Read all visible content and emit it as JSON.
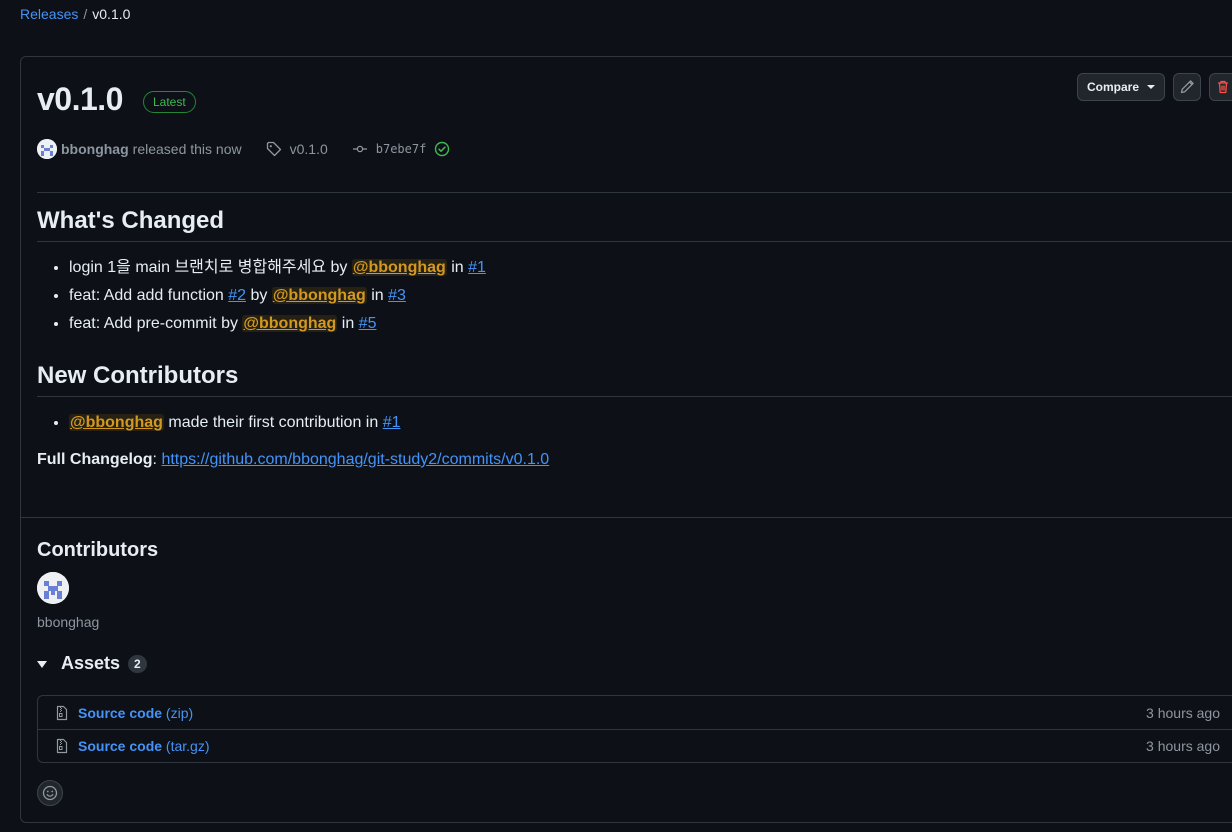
{
  "breadcrumb": {
    "releases_label": "Releases",
    "separator": "/",
    "current": "v0.1.0"
  },
  "release": {
    "title": "v0.1.0",
    "badge": "Latest",
    "author": "bbonghag",
    "released_text": "released this now",
    "tag": "v0.1.0",
    "commit": "b7ebe7f",
    "commit_status": "verified-check"
  },
  "actions": {
    "compare_label": "Compare",
    "edit_icon": "pencil-icon",
    "delete_icon": "trash-icon"
  },
  "whats_changed": {
    "heading": "What's Changed",
    "items": [
      {
        "text": "login 1을 main 브랜치로 병합해주세요 by ",
        "mention": "@bbonghag",
        "in": " in ",
        "link": "#1"
      },
      {
        "text_a": "feat: Add add function ",
        "link_a": "#2",
        "by": " by ",
        "mention": "@bbonghag",
        "in": " in ",
        "link": "#3"
      },
      {
        "text": "feat: Add pre-commit by ",
        "mention": "@bbonghag",
        "in": " in ",
        "link": "#5"
      }
    ]
  },
  "new_contributors": {
    "heading": "New Contributors",
    "items": [
      {
        "mention": "@bbonghag",
        "text": " made their first contribution in ",
        "link": "#1"
      }
    ]
  },
  "changelog": {
    "label": "Full Changelog",
    "colon": ": ",
    "url": "https://github.com/bbonghag/git-study2/commits/v0.1.0"
  },
  "contributors": {
    "heading": "Contributors",
    "names": [
      "bbonghag"
    ]
  },
  "assets": {
    "heading": "Assets",
    "count": "2",
    "items": [
      {
        "name": "Source code",
        "ext": "(zip)",
        "time": "3 hours ago"
      },
      {
        "name": "Source code",
        "ext": "(tar.gz)",
        "time": "3 hours ago"
      }
    ]
  },
  "colors": {
    "accent": "#4493f8",
    "success": "#3fb950",
    "mention": "#d29922",
    "danger": "#f85149"
  }
}
